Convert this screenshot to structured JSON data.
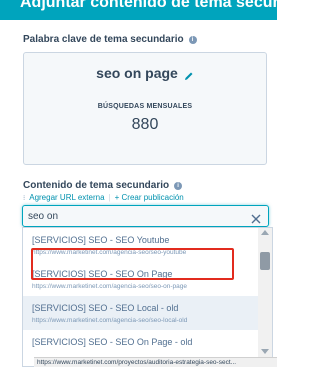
{
  "header": {
    "title": "Adjuntar contenido de tema secundario"
  },
  "keyword_section": {
    "label": "Palabra clave de tema secundario",
    "info_icon": "info-icon",
    "keyword": "seo on page",
    "edit_icon": "pencil-icon",
    "volume_label": "BÚSQUEDAS MENSUALES",
    "volume_value": "880"
  },
  "content_section": {
    "label": "Contenido de tema secundario",
    "info_icon": "info-icon",
    "add_url_label": "Agregar URL externa",
    "separator": "|",
    "create_label": "+ Crear publicación"
  },
  "search": {
    "value": "seo on",
    "clear_icon": "close-icon"
  },
  "options": [
    {
      "title": "[SERVICIOS] SEO - SEO Youtube",
      "url": "https://www.marketinet.com/agencia-seo/seo-youtube"
    },
    {
      "title": "[SERVICIOS] SEO - SEO On Page",
      "url": "https://www.marketinet.com/agencia-seo/seo-on-page"
    },
    {
      "title": "[SERVICIOS] SEO - SEO Local - old",
      "url": "https://www.marketinet.com/agencia-seo/seo-local-old"
    },
    {
      "title": "[SERVICIOS] SEO - SEO On Page - old",
      "url": ""
    }
  ],
  "status_bar": {
    "url": "https://www.marketinet.com/proyectos/auditoria-estrategia-seo-sect..."
  },
  "colors": {
    "accent": "#00a4bd",
    "highlight": "#e22b1e",
    "text": "#33475b",
    "link": "#0091ae"
  }
}
